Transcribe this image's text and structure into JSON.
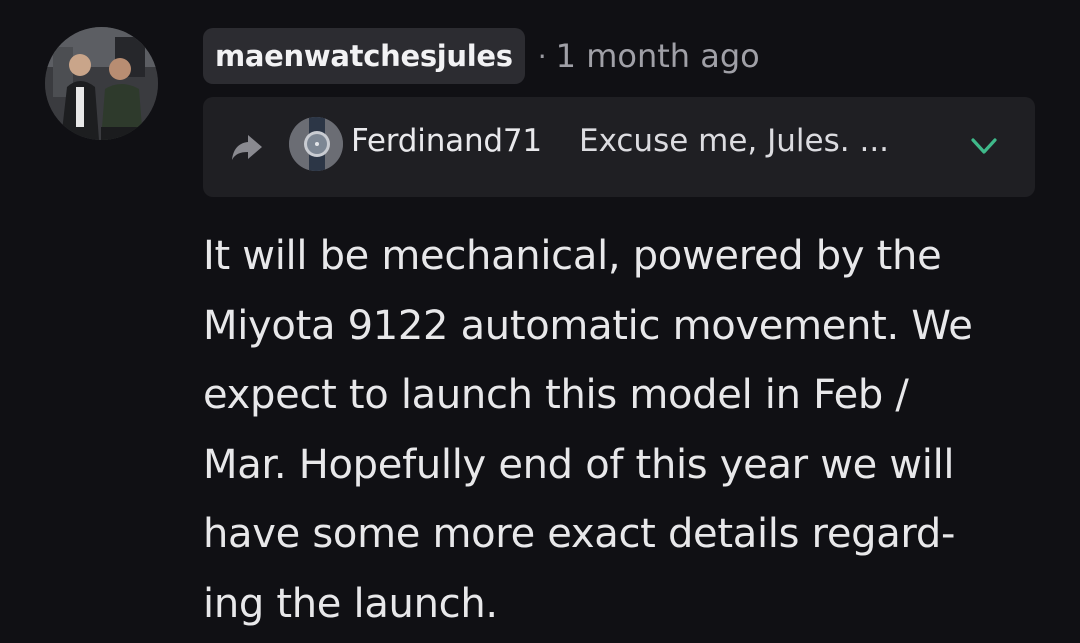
{
  "comment": {
    "author": "maenwatchesjules",
    "separator": "·",
    "timestamp": "1 month ago",
    "body_lines": [
      "It will be mechanical, powered by the",
      "Miyota 9122 automatic movement. We",
      "expect to launch this model in Feb /",
      "Mar. Hopefully end of this year we will",
      "have some more exact details regard-",
      "ing the launch."
    ]
  },
  "reply_context": {
    "icon": "reply-arrow-icon",
    "author": "Ferdinand71",
    "excerpt": "Excuse me, Jules. ...",
    "expand_icon": "chevron-down-icon"
  },
  "colors": {
    "background": "#101014",
    "chip": "#2c2c31",
    "reply_box": "#1f1f23",
    "accent": "#3fb98a"
  }
}
